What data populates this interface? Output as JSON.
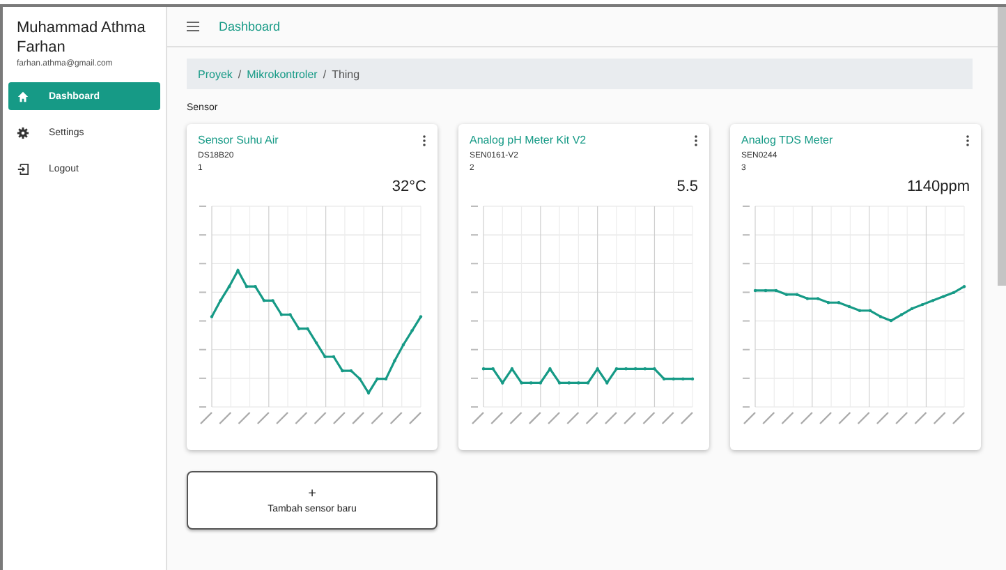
{
  "sidebar": {
    "user_name": "Muhammad Athma Farhan",
    "user_email": "farhan.athma@gmail.com",
    "items": [
      {
        "label": "Dashboard",
        "kind": "home",
        "selected": true
      },
      {
        "label": "Settings",
        "kind": "settings",
        "selected": false
      },
      {
        "label": "Logout",
        "kind": "logout",
        "selected": false
      }
    ]
  },
  "header": {
    "title": "Dashboard"
  },
  "breadcrumb": [
    {
      "label": "Proyek",
      "link": true
    },
    {
      "separator": "/",
      "label": "Mikrokontroler",
      "link": true
    },
    {
      "separator": "/",
      "label": "Thing",
      "link": false
    }
  ],
  "section_title": "Sensor",
  "sensors": [
    {
      "title": "Sensor Suhu Air",
      "model": "DS18B20",
      "id": "1",
      "reading": "32°C"
    },
    {
      "title": "Analog pH Meter Kit V2",
      "model": "SEN0161-V2",
      "id": "2",
      "reading": "5.5"
    },
    {
      "title": "Analog TDS Meter",
      "model": "SEN0244",
      "id": "3",
      "reading": "1140ppm"
    }
  ],
  "add_button": {
    "icon": "+",
    "label": "Tambah sensor baru"
  }
}
